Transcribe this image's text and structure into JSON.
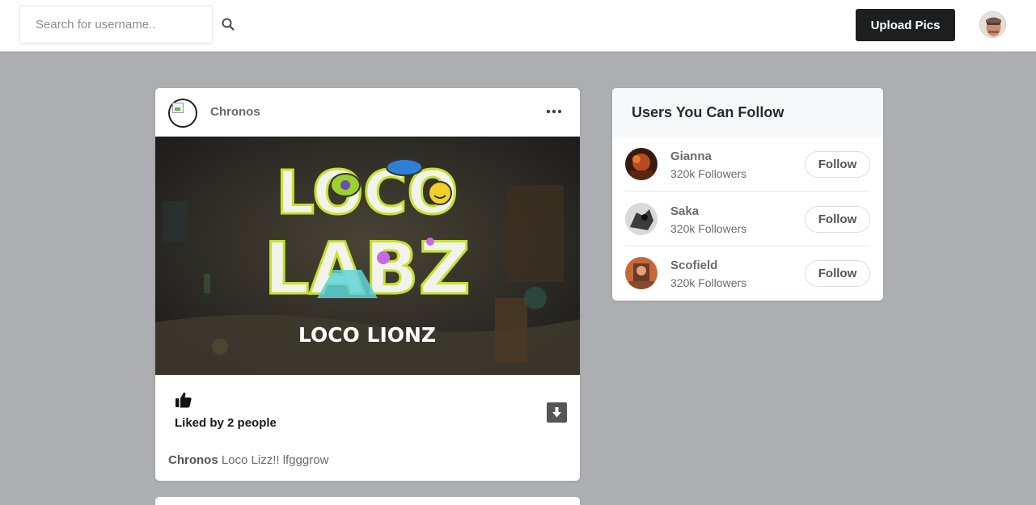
{
  "header": {
    "search_placeholder": "Search for username..",
    "upload_label": "Upload Pics"
  },
  "post": {
    "username": "Chronos",
    "image_text": {
      "line1": "LOCO",
      "line2": "LABZ",
      "subtitle": "LOCO LIONZ"
    },
    "liked_text": "Liked by 2 people",
    "caption_user": "Chronos",
    "caption_text": "Loco Lizz!! lfgggrow"
  },
  "sidebar": {
    "title": "Users You Can Follow",
    "users": [
      {
        "name": "Gianna",
        "followers": "320k Followers",
        "button": "Follow"
      },
      {
        "name": "Saka",
        "followers": "320k Followers",
        "button": "Follow"
      },
      {
        "name": "Scofield",
        "followers": "320k Followers",
        "button": "Follow"
      }
    ]
  },
  "colors": {
    "background": "#acaeb2",
    "upload_button": "#1d1e20",
    "accent_lime": "#c6e12a"
  },
  "icons": {
    "search": "search-icon",
    "more": "more-dots-icon",
    "like": "thumbs-up-icon",
    "download": "download-icon"
  }
}
